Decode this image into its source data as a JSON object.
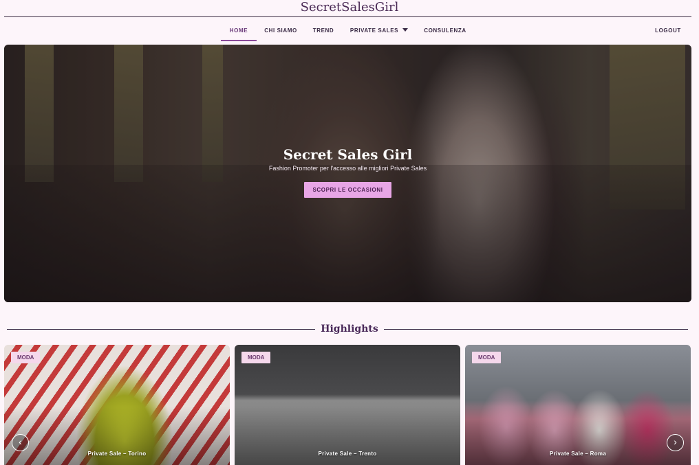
{
  "brand": {
    "name": "SecretSalesGirl"
  },
  "nav": {
    "items": [
      {
        "label": "HOME",
        "active": true
      },
      {
        "label": "CHI SIAMO"
      },
      {
        "label": "TREND"
      },
      {
        "label": "PRIVATE SALES",
        "dropdown": true
      },
      {
        "label": "CONSULENZA"
      }
    ],
    "logout": "LOGOUT"
  },
  "hero": {
    "title": "Secret Sales Girl",
    "subtitle": "Fashion Promoter per l'accesso alle migliori Private Sales",
    "cta": "SCOPRI LE OCCASIONI"
  },
  "highlights": {
    "title": "Highlights",
    "cards": [
      {
        "badge": "MODA",
        "caption": "Private Sale  –  Torino"
      },
      {
        "badge": "MODA",
        "caption": "Private Sale  –  Trento"
      },
      {
        "badge": "MODA",
        "caption": "Private Sale  –  Roma"
      }
    ],
    "prev_icon": "chevron-left-icon",
    "next_icon": "chevron-right-icon"
  },
  "colors": {
    "accent": "#e8a6e6",
    "background": "#fdf5fa",
    "brand_text": "#4a2a55"
  }
}
